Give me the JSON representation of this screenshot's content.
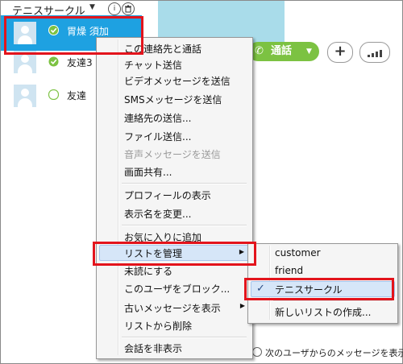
{
  "group": {
    "title": "テニスサークル",
    "caret": "▼",
    "info_icon": "i",
    "delete_icon": "🗑"
  },
  "contacts": [
    {
      "name": "胃燥 須加"
    },
    {
      "name": "友達3"
    },
    {
      "name": "友達"
    }
  ],
  "toolbar": {
    "call_label": "通話",
    "call_caret": "▼",
    "add_label": "+"
  },
  "context_menu": {
    "items": [
      {
        "label": "この連絡先と通話"
      },
      {
        "label": "チャット送信"
      },
      {
        "label": "ビデオメッセージを送信"
      },
      {
        "label": "SMSメッセージを送信"
      },
      {
        "label": "連絡先の送信..."
      },
      {
        "label": "ファイル送信..."
      },
      {
        "label": "音声メッセージを送信"
      },
      {
        "label": "画面共有..."
      },
      {
        "label": "プロフィールの表示"
      },
      {
        "label": "表示名を変更..."
      },
      {
        "label": "お気に入りに追加"
      },
      {
        "label": "リストを管理"
      },
      {
        "label": "未読にする"
      },
      {
        "label": "このユーザをブロック..."
      },
      {
        "label": "古いメッセージを表示"
      },
      {
        "label": "リストから削除"
      },
      {
        "label": "会話を非表示"
      }
    ]
  },
  "submenu": {
    "items": [
      {
        "label": "customer"
      },
      {
        "label": "friend"
      },
      {
        "label": "テニスサークル",
        "check": "✓"
      },
      {
        "label": "新しいリストの作成..."
      }
    ]
  },
  "footer": {
    "note": "次のユーザからのメッセージを表示:"
  },
  "colors": {
    "selected": "#1ea1e1",
    "call_green": "#7cc242",
    "highlight_red": "#e3141c",
    "banner": "#a9dcea"
  }
}
